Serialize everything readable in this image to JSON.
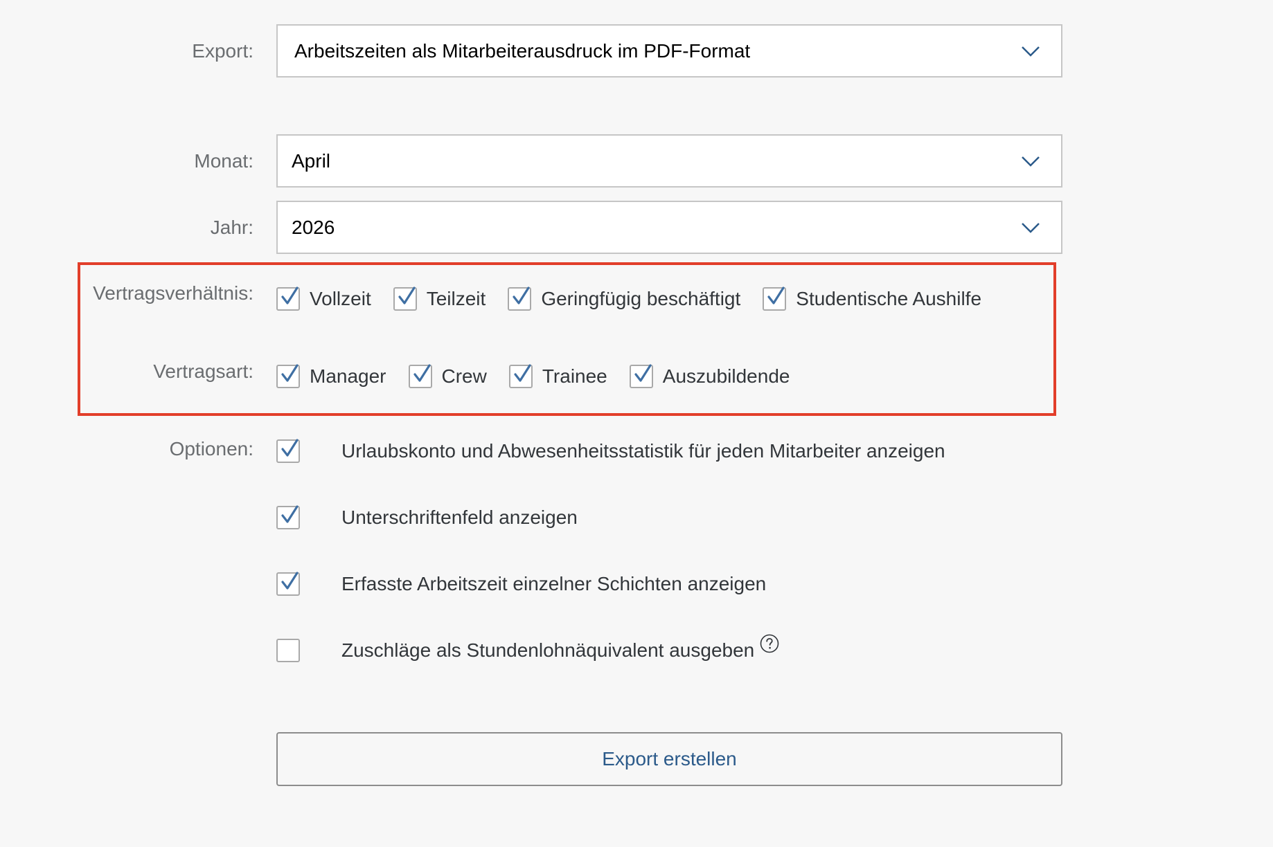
{
  "export": {
    "label": "Export:",
    "value": "Arbeitszeiten als Mitarbeiterausdruck im PDF-Format",
    "icon": "chevron-down-icon"
  },
  "month": {
    "label": "Monat:",
    "value": "April",
    "icon": "chevron-down-icon"
  },
  "year": {
    "label": "Jahr:",
    "value": "2026",
    "icon": "chevron-down-icon"
  },
  "contract_relationship": {
    "label": "Vertragsverhältnis:",
    "items": [
      {
        "label": "Vollzeit",
        "checked": true
      },
      {
        "label": "Teilzeit",
        "checked": true
      },
      {
        "label": "Geringfügig beschäftigt",
        "checked": true
      },
      {
        "label": "Studentische Aushilfe",
        "checked": true
      }
    ]
  },
  "contract_type": {
    "label": "Vertragsart:",
    "items": [
      {
        "label": "Manager",
        "checked": true
      },
      {
        "label": "Crew",
        "checked": true
      },
      {
        "label": "Trainee",
        "checked": true
      },
      {
        "label": "Auszubildende",
        "checked": true
      }
    ]
  },
  "options": {
    "label": "Optionen:",
    "items": [
      {
        "label": "Urlaubskonto und Abwesenheitsstatistik für jeden Mitarbeiter anzeigen",
        "checked": true
      },
      {
        "label": "Unterschriftenfeld anzeigen",
        "checked": true
      },
      {
        "label": "Erfasste Arbeitszeit einzelner Schichten anzeigen",
        "checked": true
      },
      {
        "label": "Zuschläge als Stundenlohnäquivalent ausgeben",
        "checked": false,
        "help_icon": "question-circle-icon"
      }
    ]
  },
  "submit": {
    "label": "Export erstellen"
  },
  "colors": {
    "highlight": "#e23e2a",
    "check": "#3f6fa3",
    "button_text": "#2b5a8a"
  }
}
